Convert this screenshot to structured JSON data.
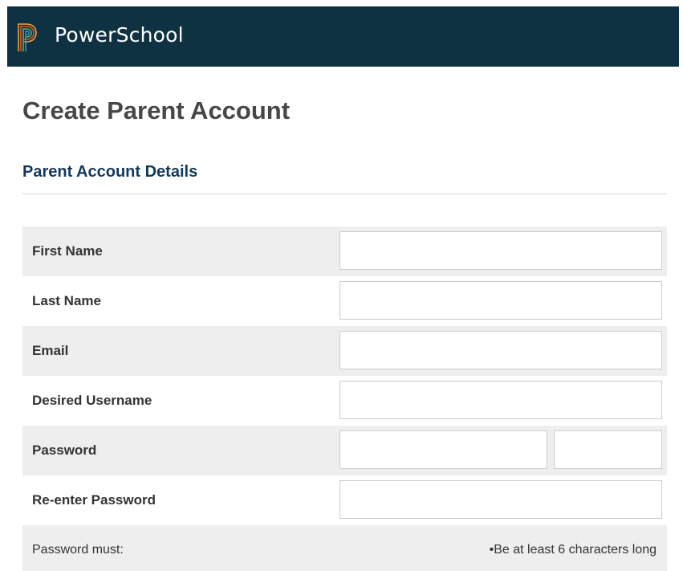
{
  "header": {
    "brand": "PowerSchool",
    "logo_icon": "powerschool-p-logo-icon",
    "background_color": "#0f3242"
  },
  "page": {
    "title": "Create Parent Account"
  },
  "section": {
    "title": "Parent Account Details"
  },
  "form": {
    "first_name": {
      "label": "First Name",
      "value": ""
    },
    "last_name": {
      "label": "Last Name",
      "value": ""
    },
    "email": {
      "label": "Email",
      "value": ""
    },
    "username": {
      "label": "Desired Username",
      "value": ""
    },
    "password": {
      "label": "Password",
      "value": "",
      "strength_value": ""
    },
    "reenter_password": {
      "label": "Re-enter Password",
      "value": ""
    }
  },
  "password_rules": {
    "label": "Password must:",
    "items": [
      "•Be at least 6 characters long"
    ]
  },
  "colors": {
    "header_bg": "#0f3242",
    "section_title": "#13385a",
    "row_shade": "#eeeeee"
  }
}
